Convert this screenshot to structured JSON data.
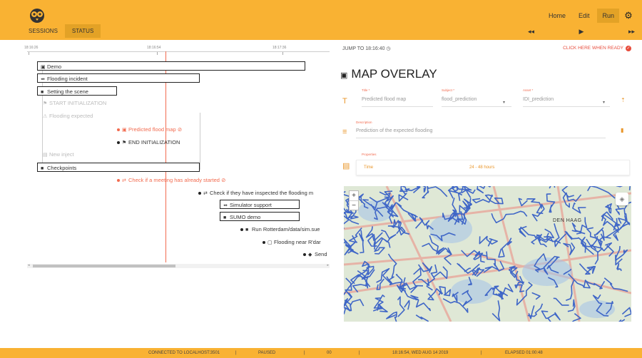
{
  "nav": {
    "home": "Home",
    "edit": "Edit",
    "run": "Run"
  },
  "tabs": {
    "sessions": "SESSIONS",
    "status": "STATUS"
  },
  "controls": {
    "rewind": "◂◂",
    "play": "▶",
    "forward": "▸▸"
  },
  "timeline": {
    "ticks": [
      "18:16:26",
      "18:16:54",
      "18:17:36"
    ],
    "items": [
      {
        "label": "Demo",
        "icon": "▣"
      },
      {
        "label": "Flooding incident",
        "icon": "⇴"
      },
      {
        "label": "Setting the scene",
        "icon": "■"
      },
      {
        "label": "START INITIALIZATION",
        "icon": "⚑"
      },
      {
        "label": "Flooding expected",
        "icon": "⚠"
      },
      {
        "label": "Predicted flood map",
        "icon": "▣"
      },
      {
        "label": "END INITIALIZATION",
        "icon": "⚑"
      },
      {
        "label": "New inject",
        "icon": "▤"
      },
      {
        "label": "Checkpoints",
        "icon": "■"
      },
      {
        "label": "Check if a meeting has already started",
        "icon": "⇄"
      },
      {
        "label": "Check if they have inspected the flooding m",
        "icon": "⇄"
      },
      {
        "label": "Simulator support",
        "icon": "⇴"
      },
      {
        "label": "SUMO demo",
        "icon": "■"
      },
      {
        "label": "Run Rotterdam/data/sim.sue",
        "icon": "■"
      },
      {
        "label": "Flooding near R'dar",
        "icon": "▢"
      },
      {
        "label": "Send",
        "icon": "◆"
      }
    ]
  },
  "panel": {
    "jump": "JUMP TO 18:16:40",
    "ready": "CLICK HERE WHEN READY",
    "title": "MAP OVERLAY",
    "title_label": "Title *",
    "title_value": "Predicted flood map",
    "subject_label": "Subject *",
    "subject_value": "flood_prediction",
    "asset_label": "Asset *",
    "asset_value": "IDI_prediction",
    "description_label": "Description",
    "description_value": "Prediction of the expected flooding",
    "properties_label": "Properties",
    "prop_key": "Time",
    "prop_value": "24 - 48 hours",
    "city": "DEN HAAG"
  },
  "status": {
    "connected": "CONNECTED TO LOCALHOST:3501",
    "state": "PAUSED",
    "count": "00",
    "time": "18:16:54, WED AUG 14 2019",
    "elapsed": "ELAPSED 01:00:48"
  },
  "colors": {
    "accent": "#f9b233",
    "accent_dark": "#e3a226",
    "timeline_now": "#f26b4f",
    "flood": "#3f66c7"
  }
}
